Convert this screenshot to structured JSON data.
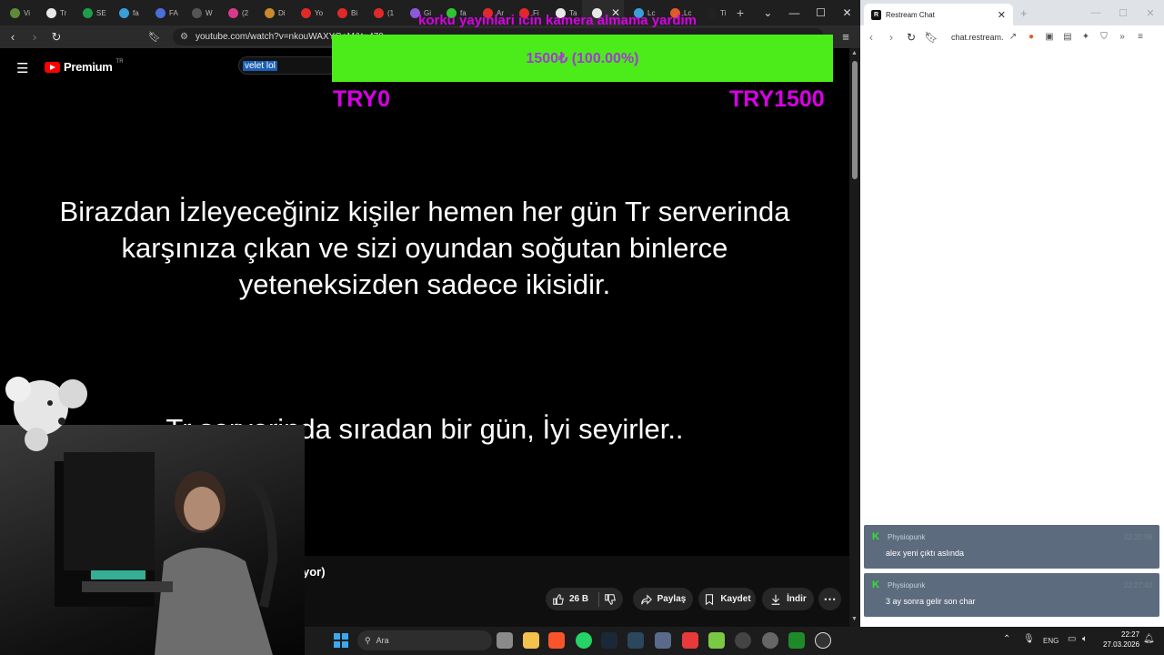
{
  "left_browser": {
    "tabs": [
      {
        "label": "Vi",
        "color": "#5f8a3a"
      },
      {
        "label": "Tr",
        "color": "#e8e8e8"
      },
      {
        "label": "SE",
        "color": "#1e9e4a"
      },
      {
        "label": "fa",
        "color": "#3a9ed8"
      },
      {
        "label": "FA",
        "color": "#4a6fd8"
      },
      {
        "label": "W",
        "color": "#555555"
      },
      {
        "label": "(2",
        "color": "#d83a8a"
      },
      {
        "label": "Di",
        "color": "#c88a2a"
      },
      {
        "label": "Yo",
        "color": "#e02a2a"
      },
      {
        "label": "Bi",
        "color": "#e02a2a"
      },
      {
        "label": "(1",
        "color": "#e02a2a"
      },
      {
        "label": "Gi",
        "color": "#8a5ad8"
      },
      {
        "label": "fa",
        "color": "#2ec82e"
      },
      {
        "label": "Ar",
        "color": "#e02a2a"
      },
      {
        "label": "Fi",
        "color": "#e02a2a"
      },
      {
        "label": "Ta",
        "color": "#e8e8e8"
      },
      {
        "label": "",
        "color": "#e8e8e8",
        "active": true
      },
      {
        "label": "Lc",
        "color": "#3a9ed8"
      },
      {
        "label": "Lc",
        "color": "#e05a2a"
      },
      {
        "label": "Ti",
        "color": "#222222"
      }
    ],
    "url": "youtube.com/watch?v=nkouWAXYGaM&t=479"
  },
  "youtube": {
    "logo_text": "Premium",
    "logo_badge": "TR",
    "search_query": "velet lol",
    "video_caption_1": "Birazdan İzleyeceğiniz kişiler hemen her gün Tr serverinda karşınıza çıkan ve sizi oyundan soğutan binlerce yeteneksizden sadece ikisidir.",
    "video_caption_2": "Tr serverinda sıradan bir gün, İyi seyirler..",
    "title_fragment": "yor)",
    "like_count": "26 B",
    "share_label": "Paylaş",
    "save_label": "Kaydet",
    "download_label": "İndir"
  },
  "overlay": {
    "goal_title": "korku yayinlari icin kamera almama yardim",
    "goal_text": "1500₺ (100.00%)",
    "goal_progress": 1.0,
    "goal_min": "TRY0",
    "goal_max": "TRY1500",
    "fill_color": "#4bec1a",
    "text_color": "#d900e6"
  },
  "right_browser": {
    "tab_title": "Restream Chat",
    "url": "chat.restream.io",
    "messages": [
      {
        "user": "Physiopunk",
        "time": "22:22:08",
        "text": "alex yeni çıktı aslında"
      },
      {
        "user": "Physiopunk",
        "time": "22:27:43",
        "text": "3 ay sonra gelir son char"
      }
    ]
  },
  "taskbar": {
    "search_placeholder": "Ara",
    "language": "ENG",
    "time": "22:27",
    "date": "27.03.2026"
  }
}
